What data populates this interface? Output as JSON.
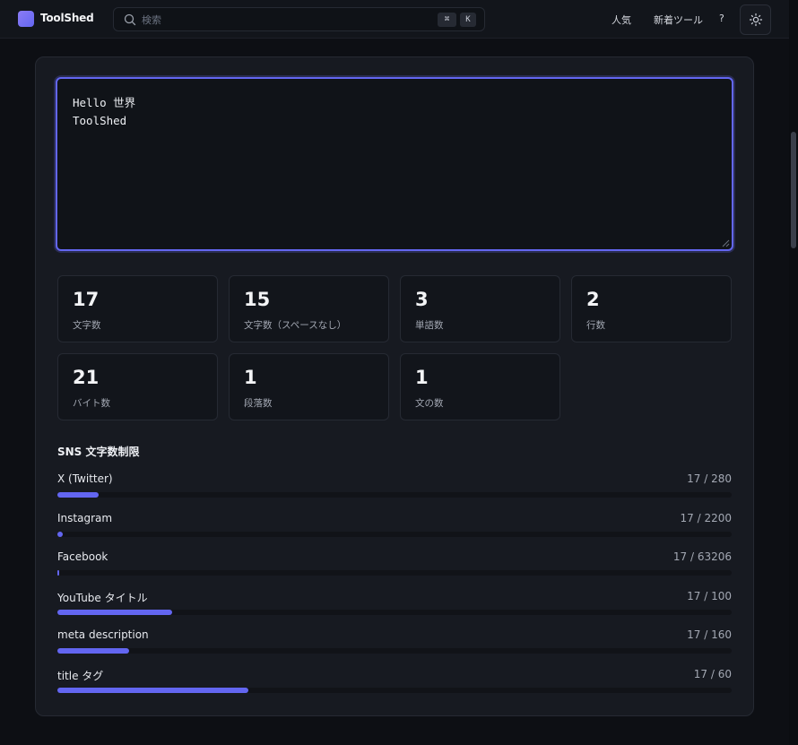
{
  "app": {
    "name": "ToolShed"
  },
  "search": {
    "placeholder": "検索",
    "value": "",
    "shortcut_mod": "⌘",
    "shortcut_key": "K"
  },
  "nav": {
    "popular": "人気",
    "new_tools": "新着ツール",
    "help": "?"
  },
  "editor": {
    "value": "Hello 世界\nToolShed"
  },
  "stats": [
    {
      "value": "17",
      "label": "文字数"
    },
    {
      "value": "15",
      "label": "文字数（スペースなし）"
    },
    {
      "value": "3",
      "label": "単語数"
    },
    {
      "value": "2",
      "label": "行数"
    },
    {
      "value": "21",
      "label": "バイト数"
    },
    {
      "value": "1",
      "label": "段落数"
    },
    {
      "value": "1",
      "label": "文の数"
    }
  ],
  "sns": {
    "title": "SNS 文字数制限",
    "items": [
      {
        "name": "X (Twitter)",
        "count": "17 / 280",
        "used": 17,
        "limit": 280
      },
      {
        "name": "Instagram",
        "count": "17 / 2200",
        "used": 17,
        "limit": 2200
      },
      {
        "name": "Facebook",
        "count": "17 / 63206",
        "used": 17,
        "limit": 63206
      },
      {
        "name": "YouTube タイトル",
        "count": "17 / 100",
        "used": 17,
        "limit": 100
      },
      {
        "name": "meta description",
        "count": "17 / 160",
        "used": 17,
        "limit": 160
      },
      {
        "name": "title タグ",
        "count": "17 / 60",
        "used": 17,
        "limit": 60
      }
    ]
  },
  "colors": {
    "accent": "#6366f1",
    "background": "#0d0f14",
    "card": "#171a21"
  },
  "icons": {
    "search": "search-icon",
    "theme": "sun-icon",
    "logo": "logo-icon"
  }
}
